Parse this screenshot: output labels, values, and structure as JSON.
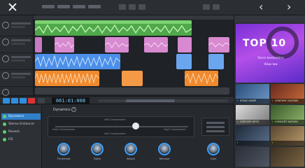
{
  "window": {
    "close_icon": "close-icon",
    "nav_prev_icon": "chevron-left-icon",
    "nav_next_icon": "chevron-right-icon"
  },
  "transport": {
    "time_display": "061:01:008"
  },
  "effects_panel": {
    "items": [
      {
        "label": "Dynamics",
        "active": true
      },
      {
        "label": "Stereo Enhancer",
        "active": false
      },
      {
        "label": "Reverb",
        "active": false
      },
      {
        "label": "EQ",
        "active": false
      }
    ],
    "title": "Dynamics",
    "help": "?",
    "slider_labels": {
      "top": "Soft Compression",
      "left": "Hard Compression",
      "right": "High Compression",
      "bottom": "Soft Compression"
    },
    "knobs": [
      "Threshold",
      "Ratio",
      "Attack",
      "Release",
      "Gain"
    ]
  },
  "store": {
    "banner_title": "TOP 10",
    "banner_subtitle": "Store bestsellers",
    "banner_link": "View now",
    "tiles": [
      "SONIC HAMP",
      "CENTURY GUITARS",
      "CENTURY KEYS",
      "CONCERT NATURE",
      "",
      ""
    ]
  },
  "colors": {
    "accent_blue": "#2f8ee0",
    "track_green": "#5cbf52",
    "track_pink": "#d78ad0",
    "track_blue": "#4b8fe8",
    "track_orange": "#f08a2e",
    "store_purple": "#9a3fe0"
  }
}
